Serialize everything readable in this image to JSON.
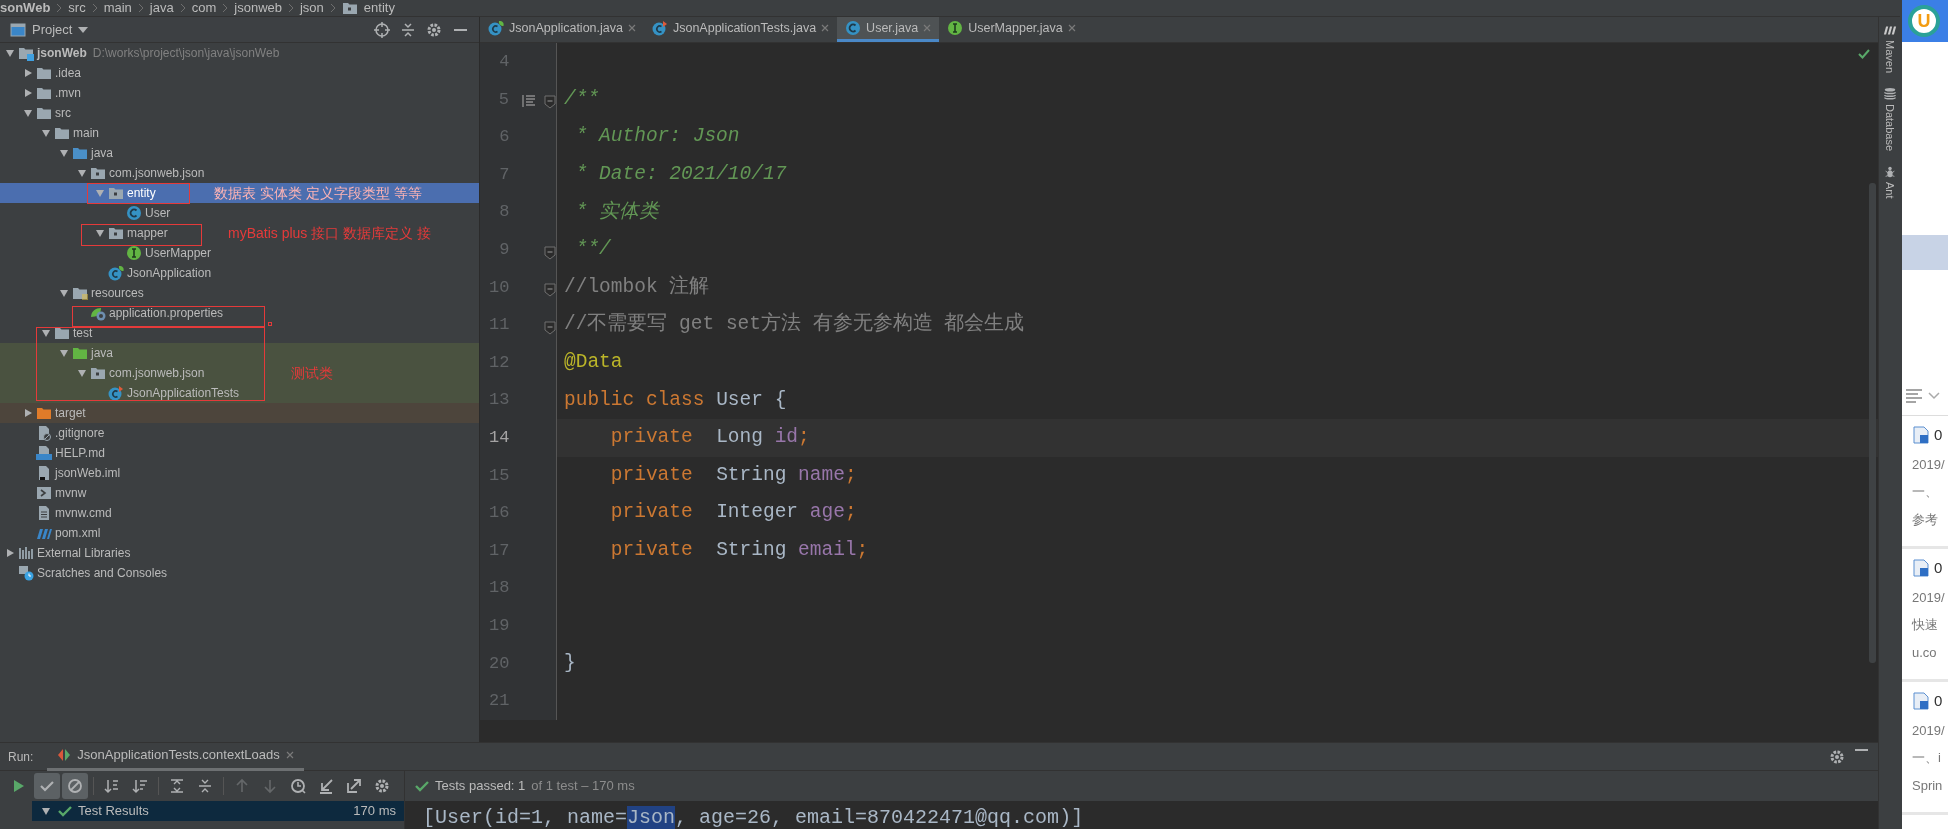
{
  "breadcrumbs": [
    {
      "label": "sonWeb",
      "kind": "module"
    },
    {
      "label": "src",
      "kind": "plain"
    },
    {
      "label": "main",
      "kind": "plain"
    },
    {
      "label": "java",
      "kind": "plain"
    },
    {
      "label": "com",
      "kind": "plain"
    },
    {
      "label": "jsonweb",
      "kind": "plain"
    },
    {
      "label": "json",
      "kind": "plain"
    },
    {
      "label": "entity",
      "kind": "package"
    }
  ],
  "project_panel": {
    "title": "Project"
  },
  "tree": [
    {
      "label": "jsonWeb",
      "kind": "module",
      "path": "D:\\works\\project\\json\\java\\jsonWeb",
      "expanded": true,
      "selected": false,
      "children": [
        {
          "label": ".idea",
          "kind": "folder",
          "expanded": false,
          "selected": false
        },
        {
          "label": ".mvn",
          "kind": "folder",
          "expanded": false,
          "selected": false
        },
        {
          "label": "src",
          "kind": "folder",
          "expanded": true,
          "selected": false,
          "children": [
            {
              "label": "main",
              "kind": "folder",
              "expanded": true,
              "selected": false,
              "children": [
                {
                  "label": "java",
                  "kind": "source_root",
                  "expanded": true,
                  "selected": false,
                  "children": [
                    {
                      "label": "com.jsonweb.json",
                      "kind": "package",
                      "expanded": true,
                      "selected": false,
                      "children": [
                        {
                          "label": "entity",
                          "kind": "package",
                          "expanded": true,
                          "selected": true,
                          "note": "数据表 实体类 定义字段类型 等等",
                          "children": [
                            {
                              "label": "User",
                              "kind": "class",
                              "selected": false
                            }
                          ]
                        },
                        {
                          "label": "mapper",
                          "kind": "package",
                          "expanded": true,
                          "selected": false,
                          "note": "myBatis plus 接口 数据库定义 接",
                          "children": [
                            {
                              "label": "UserMapper",
                              "kind": "interface",
                              "selected": false
                            }
                          ]
                        },
                        {
                          "label": "JsonApplication",
                          "kind": "spring_class",
                          "selected": false
                        }
                      ]
                    }
                  ]
                },
                {
                  "label": "resources",
                  "kind": "resource_root",
                  "expanded": true,
                  "selected": false,
                  "children": [
                    {
                      "label": "application.properties",
                      "kind": "properties",
                      "selected": false
                    }
                  ]
                }
              ]
            },
            {
              "label": "test",
              "kind": "folder",
              "expanded": true,
              "selected": false,
              "children": [
                {
                  "label": "java",
                  "kind": "test_root",
                  "expanded": true,
                  "selected": false,
                  "test_scope": true,
                  "children": [
                    {
                      "label": "com.jsonweb.json",
                      "kind": "package",
                      "expanded": true,
                      "selected": false,
                      "test_scope": true,
                      "note": "测试类",
                      "children": [
                        {
                          "label": "JsonApplicationTests",
                          "kind": "test_class",
                          "selected": false,
                          "test_scope": true
                        }
                      ]
                    }
                  ]
                }
              ]
            }
          ]
        },
        {
          "label": "target",
          "kind": "excluded_folder",
          "expanded": false,
          "selected": false,
          "excluded": true
        },
        {
          "label": ".gitignore",
          "kind": "gitignore",
          "selected": false
        },
        {
          "label": "HELP.md",
          "kind": "markdown",
          "selected": false
        },
        {
          "label": "jsonWeb.iml",
          "kind": "iml",
          "selected": false
        },
        {
          "label": "mvnw",
          "kind": "script",
          "selected": false
        },
        {
          "label": "mvnw.cmd",
          "kind": "text",
          "selected": false
        },
        {
          "label": "pom.xml",
          "kind": "maven",
          "selected": false
        }
      ]
    },
    {
      "label": "External Libraries",
      "kind": "libraries",
      "expanded": false,
      "selected": false
    },
    {
      "label": "Scratches and Consoles",
      "kind": "scratches",
      "selected": false
    }
  ],
  "editor_tabs": [
    {
      "label": "JsonApplication.java",
      "kind": "spring_class",
      "selected": false
    },
    {
      "label": "JsonApplicationTests.java",
      "kind": "test_class",
      "selected": false
    },
    {
      "label": "User.java",
      "kind": "class",
      "selected": true
    },
    {
      "label": "UserMapper.java",
      "kind": "interface",
      "selected": false
    }
  ],
  "code_lines": [
    {
      "number": "4",
      "current": false,
      "fold": false
    },
    {
      "number": "5",
      "current": false,
      "fold": true,
      "doc_toggle": true,
      "tokens": [
        {
          "text": "/**",
          "kind": "doc"
        }
      ]
    },
    {
      "number": "6",
      "current": false,
      "fold": false,
      "tokens": [
        {
          "text": " * Author: Json",
          "kind": "doc"
        }
      ]
    },
    {
      "number": "7",
      "current": false,
      "fold": false,
      "tokens": [
        {
          "text": " * Date: 2021/10/17",
          "kind": "doc"
        }
      ]
    },
    {
      "number": "8",
      "current": false,
      "fold": false,
      "tokens": [
        {
          "text": " * 实体类",
          "kind": "doc"
        }
      ]
    },
    {
      "number": "9",
      "current": false,
      "fold": true,
      "tokens": [
        {
          "text": " **/",
          "kind": "doc"
        }
      ]
    },
    {
      "number": "10",
      "current": false,
      "fold": true,
      "tokens": [
        {
          "text": "//lombok 注解",
          "kind": "comment"
        }
      ]
    },
    {
      "number": "11",
      "current": false,
      "fold": true,
      "tokens": [
        {
          "text": "//不需要写 get set方法 有参无参构造 都会生成",
          "kind": "comment"
        }
      ]
    },
    {
      "number": "12",
      "current": false,
      "fold": false,
      "tokens": [
        {
          "text": "@Data",
          "kind": "annotation"
        }
      ]
    },
    {
      "number": "13",
      "current": false,
      "fold": false,
      "tokens": [
        {
          "text": "public class",
          "kind": "keyword"
        },
        {
          "text": " User {",
          "kind": "plain"
        }
      ]
    },
    {
      "number": "14",
      "current": true,
      "fold": false,
      "tokens": [
        {
          "text": "    private",
          "kind": "keyword"
        },
        {
          "text": "  Long ",
          "kind": "plain"
        },
        {
          "text": "id",
          "kind": "field"
        },
        {
          "text": ";",
          "kind": "keyword"
        }
      ]
    },
    {
      "number": "15",
      "current": false,
      "fold": false,
      "tokens": [
        {
          "text": "    private",
          "kind": "keyword"
        },
        {
          "text": "  String ",
          "kind": "plain"
        },
        {
          "text": "name",
          "kind": "field"
        },
        {
          "text": ";",
          "kind": "keyword"
        }
      ]
    },
    {
      "number": "16",
      "current": false,
      "fold": false,
      "tokens": [
        {
          "text": "    private",
          "kind": "keyword"
        },
        {
          "text": "  Integer ",
          "kind": "plain"
        },
        {
          "text": "age",
          "kind": "field"
        },
        {
          "text": ";",
          "kind": "keyword"
        }
      ]
    },
    {
      "number": "17",
      "current": false,
      "fold": false,
      "tokens": [
        {
          "text": "    private",
          "kind": "keyword"
        },
        {
          "text": "  String ",
          "kind": "plain"
        },
        {
          "text": "email",
          "kind": "field"
        },
        {
          "text": ";",
          "kind": "keyword"
        }
      ]
    },
    {
      "number": "18",
      "current": false,
      "fold": false
    },
    {
      "number": "19",
      "current": false,
      "fold": false
    },
    {
      "number": "20",
      "current": false,
      "fold": false,
      "tokens": [
        {
          "text": "}",
          "kind": "plain"
        }
      ]
    },
    {
      "number": "21",
      "current": false,
      "fold": false
    }
  ],
  "tool_windows": [
    {
      "label": "Maven",
      "kind": "maven"
    },
    {
      "label": "Database",
      "kind": "database"
    },
    {
      "label": "Ant",
      "kind": "ant"
    }
  ],
  "run_panel": {
    "label": "Run:",
    "tab": {
      "label": "JsonApplicationTests.contextLoads",
      "selected": true
    },
    "toolbar": [
      {
        "kind": "rerun",
        "on": false,
        "disabled": false
      },
      {
        "kind": "show_passed",
        "on": true,
        "disabled": false
      },
      {
        "kind": "show_ignored",
        "on": true,
        "disabled": false
      },
      {
        "kind": "sort_alpha",
        "on": false,
        "disabled": false
      },
      {
        "kind": "sort_duration",
        "on": false,
        "disabled": false
      },
      {
        "kind": "expand_all",
        "on": false,
        "disabled": false
      },
      {
        "kind": "collapse_all",
        "on": false,
        "disabled": false
      },
      {
        "kind": "previous",
        "on": false,
        "disabled": true
      },
      {
        "kind": "next",
        "on": false,
        "disabled": true
      },
      {
        "kind": "history",
        "on": false,
        "disabled": false
      },
      {
        "kind": "import",
        "on": false,
        "disabled": false
      },
      {
        "kind": "export",
        "on": false,
        "disabled": false
      },
      {
        "kind": "settings",
        "on": false,
        "disabled": false
      }
    ],
    "status": {
      "summary": "Tests passed: 1",
      "detail": "of 1 test – 170 ms"
    },
    "results": [
      {
        "label": "Test Results",
        "time": "170 ms",
        "selected": true
      }
    ],
    "output": [
      {
        "text": "[User(id=1, name=",
        "selected": false
      },
      {
        "text": "Json",
        "selected": true
      },
      {
        "text": ", age=26, email=870422471@qq.com)]",
        "selected": false
      }
    ]
  },
  "side_window": {
    "logo": "U",
    "items": [
      {
        "title": "0",
        "date": "2019/",
        "lines": [
          "一、",
          "参考"
        ]
      },
      {
        "title": "0",
        "date": "2019/",
        "lines": [
          "快速",
          "u.co"
        ]
      },
      {
        "title": "0",
        "date": "2019/",
        "lines": [
          "一、i",
          "Sprin"
        ]
      }
    ]
  }
}
